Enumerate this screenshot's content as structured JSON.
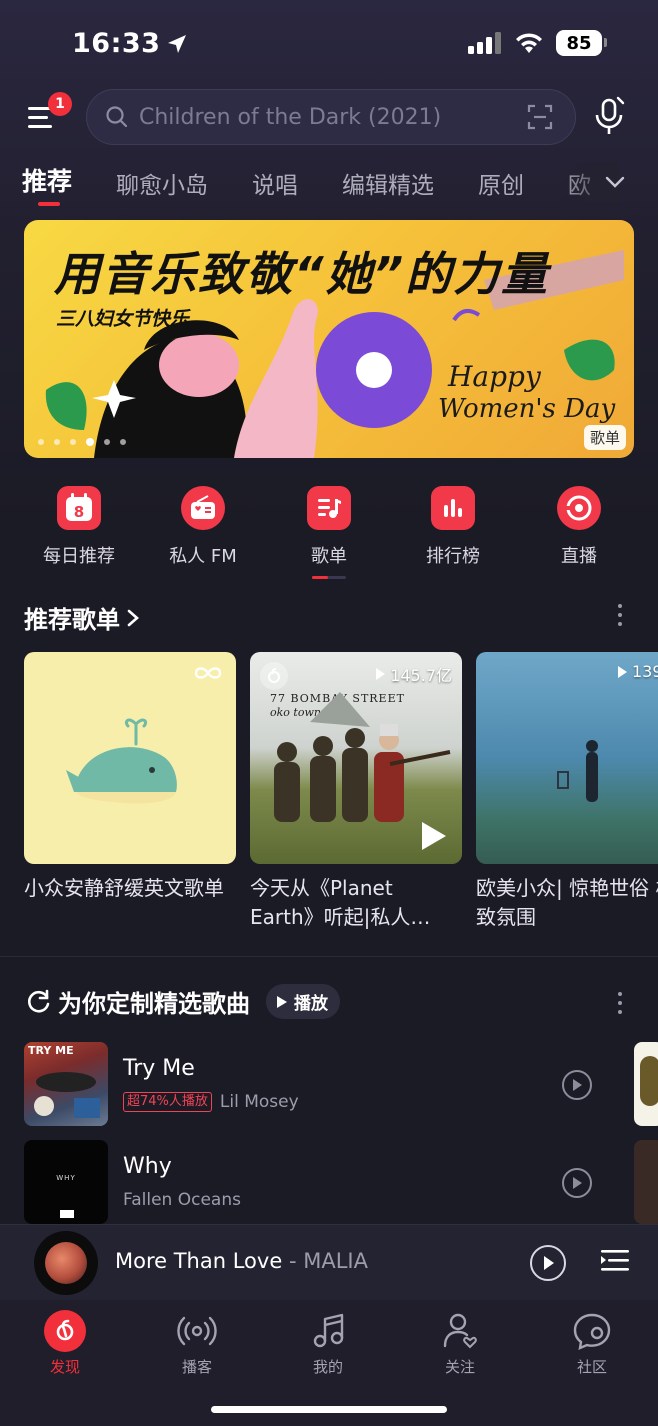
{
  "status_bar": {
    "time": "16:33",
    "battery": "85"
  },
  "header": {
    "menu_badge": "1",
    "search_placeholder": "Children of the Dark (2021)"
  },
  "tabs": [
    "推荐",
    "聊愈小岛",
    "说唱",
    "编辑精选",
    "原创",
    "欧"
  ],
  "banner": {
    "title": "用音乐致敬“她”的力量",
    "subtitle": "三八妇女节快乐",
    "en_line1": "Happy",
    "en_line2": "Women's Day",
    "tag": "歌单"
  },
  "quick_actions": [
    {
      "label": "每日推荐",
      "icon": "calendar-icon",
      "day": "8"
    },
    {
      "label": "私人 FM",
      "icon": "radio-icon"
    },
    {
      "label": "歌单",
      "icon": "playlist-icon"
    },
    {
      "label": "排行榜",
      "icon": "chart-icon"
    },
    {
      "label": "直播",
      "icon": "live-icon"
    }
  ],
  "recommended": {
    "title": "推荐歌单",
    "playlists": [
      {
        "title": "小众安静舒缓英文歌单",
        "play_count": ""
      },
      {
        "title": "今天从《Planet Earth》听起|私人…",
        "play_count": "145.7亿",
        "cover_text_1": "77 BOMBAY STREET",
        "cover_text_2": "oko town"
      },
      {
        "title": "欧美小众| 惊艳世俗 极致氛围",
        "play_count": "139"
      }
    ]
  },
  "daily": {
    "title": "为你定制精选歌曲",
    "play_label": "播放",
    "songs": [
      {
        "title": "Try Me",
        "tag": "超74%人播放",
        "artist": "Lil Mosey",
        "cover_text": "TRY ME"
      },
      {
        "title": "Why",
        "tag": "",
        "artist": "Fallen Oceans",
        "cover_text": "WHY"
      }
    ]
  },
  "mini_player": {
    "title": "More Than Love",
    "separator": " - ",
    "artist": "MALIA"
  },
  "bottom_nav": [
    {
      "label": "发现",
      "icon": "netease-logo-icon",
      "active": true
    },
    {
      "label": "播客",
      "icon": "podcast-icon"
    },
    {
      "label": "我的",
      "icon": "music-note-icon"
    },
    {
      "label": "关注",
      "icon": "follow-user-icon"
    },
    {
      "label": "社区",
      "icon": "community-chat-icon"
    }
  ],
  "colors": {
    "accent": "#f2303c",
    "background": "#1b1b26",
    "banner_yellow": "#f7d943"
  }
}
